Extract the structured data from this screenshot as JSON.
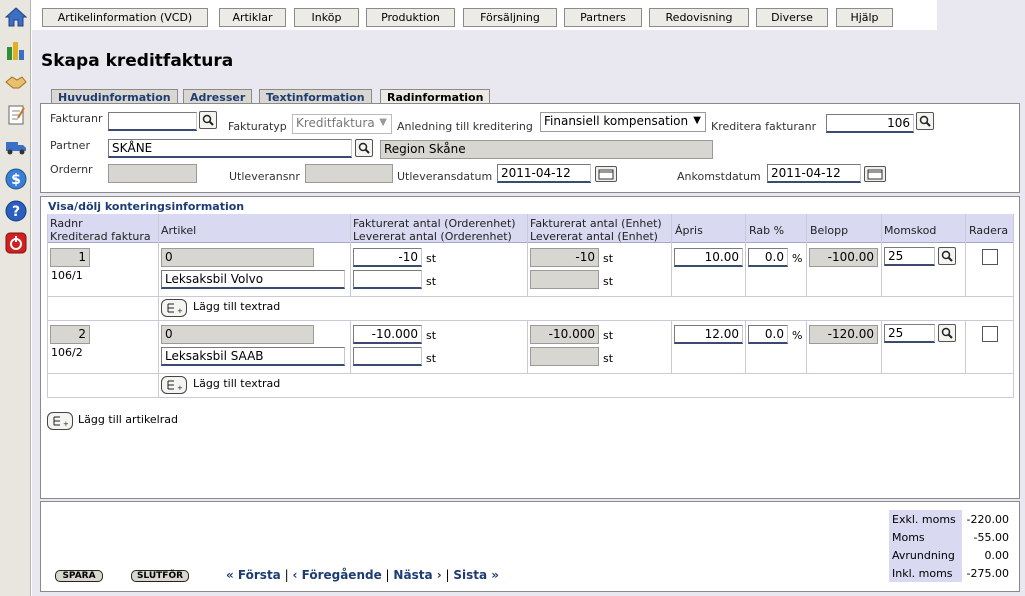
{
  "menu": [
    "Artikelinformation (VCD)",
    "Artiklar",
    "Inköp",
    "Produktion",
    "Försäljning",
    "Partners",
    "Redovisning",
    "Diverse",
    "Hjälp"
  ],
  "page_title": "Skapa kreditfaktura",
  "tabs": [
    "Huvudinformation",
    "Adresser",
    "Textinformation",
    "Radinformation"
  ],
  "header": {
    "fakturanr_label": "Fakturanr",
    "fakturanr_value": "",
    "fakturatyp_label": "Fakturatyp",
    "fakturatyp_value": "Kreditfaktura",
    "anledning_label": "Anledning till kreditering",
    "anledning_value": "Finansiell kompensation",
    "kreditera_label": "Kreditera fakturanr",
    "kreditera_value": "106",
    "partner_label": "Partner",
    "partner_value": "SKÅNE",
    "partner_name": "Region Skåne",
    "ordernr_label": "Ordernr",
    "ordernr_value": "",
    "utleveransnr_label": "Utleveransnr",
    "utleveransnr_value": "",
    "utleveransdatum_label": "Utleveransdatum",
    "utleveransdatum_value": "2011-04-12",
    "ankomstdatum_label": "Ankomstdatum",
    "ankomstdatum_value": "2011-04-12"
  },
  "section_link": "Visa/dölj konteringsinformation",
  "columns": {
    "radnr": "Radnr",
    "kredit": "Krediterad faktura",
    "artikel": "Artikel",
    "fakt_order": "Fakturerat antal (Orderenhet)",
    "lev_order": "Levererat antal (Orderenhet)",
    "fakt_enhet": "Fakturerat antal (Enhet)",
    "lev_enhet": "Levererat antal (Enhet)",
    "apris": "Ápris",
    "rab": "Rab %",
    "belopp": "Belopp",
    "momskod": "Momskod",
    "radera": "Radera"
  },
  "rows": [
    {
      "radnr": "1",
      "kredit": "106/1",
      "artikelnr": "0",
      "artikel": "Leksaksbil Volvo",
      "fakt_order": "-10",
      "lev_order": "",
      "fakt_enhet": "-10",
      "lev_enhet": "",
      "unit": "st",
      "apris": "10.00",
      "rab": "0.0",
      "pct": "%",
      "belopp": "-100.00",
      "momskod": "25",
      "add_text": "Lägg till textrad"
    },
    {
      "radnr": "2",
      "kredit": "106/2",
      "artikelnr": "0",
      "artikel": "Leksaksbil SAAB",
      "fakt_order": "-10.000",
      "lev_order": "",
      "fakt_enhet": "-10.000",
      "lev_enhet": "",
      "unit": "st",
      "apris": "12.00",
      "rab": "0.0",
      "pct": "%",
      "belopp": "-120.00",
      "momskod": "25",
      "add_text": "Lägg till textrad"
    }
  ],
  "add_article_row": "Lägg till artikelrad",
  "footer": {
    "save": "SPARA",
    "finish": "SLUTFÖR",
    "first": "« Första",
    "prev": "‹ Föregående",
    "next": "Nästa ›",
    "last": "Sista »",
    "sep": "|"
  },
  "summary": [
    {
      "label": "Exkl. moms",
      "value": "-220.00"
    },
    {
      "label": "Moms",
      "value": "-55.00"
    },
    {
      "label": "Avrundning",
      "value": "0.00"
    },
    {
      "label": "Inkl. moms",
      "value": "-275.00"
    }
  ],
  "icons": {
    "home": "home-icon",
    "chart": "chart-icon",
    "handshake": "handshake-icon",
    "document": "document-icon",
    "truck": "truck-icon",
    "money": "dollar-icon",
    "help": "help-icon",
    "logout": "power-icon"
  }
}
